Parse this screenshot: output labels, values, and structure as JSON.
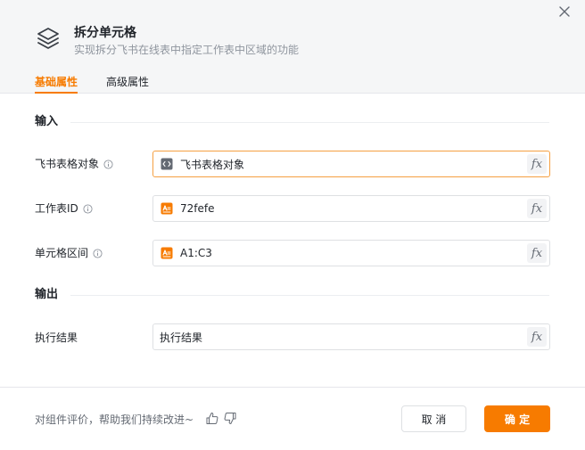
{
  "header": {
    "title": "拆分单元格",
    "subtitle": "实现拆分飞书在线表中指定工作表中区域的功能",
    "logo_icon": "layers-icon",
    "close_icon": "close-icon"
  },
  "tabs": [
    {
      "label": "基础属性",
      "active": true
    },
    {
      "label": "高级属性",
      "active": false
    }
  ],
  "sections": {
    "input_title": "输入",
    "output_title": "输出"
  },
  "fields": {
    "feishu_sheet": {
      "label": "飞书表格对象",
      "value": "飞书表格对象",
      "icon": "code-block-icon",
      "focused": true
    },
    "sheet_id": {
      "label": "工作表ID",
      "value": "72fefe",
      "icon": "text-variable-icon"
    },
    "cell_range": {
      "label": "单元格区间",
      "value": "A1:C3",
      "icon": "text-variable-icon"
    },
    "result": {
      "label": "执行结果",
      "value": "执行结果"
    },
    "fx_label": "fx"
  },
  "footer": {
    "feedback": "对组件评价，帮助我们持续改进~",
    "cancel_label": "取 消",
    "ok_label": "确 定"
  },
  "colors": {
    "accent": "#f77b00",
    "header_bg": "#f5f6f7",
    "border": "#dee0e3",
    "focus_border": "#f5a042"
  }
}
